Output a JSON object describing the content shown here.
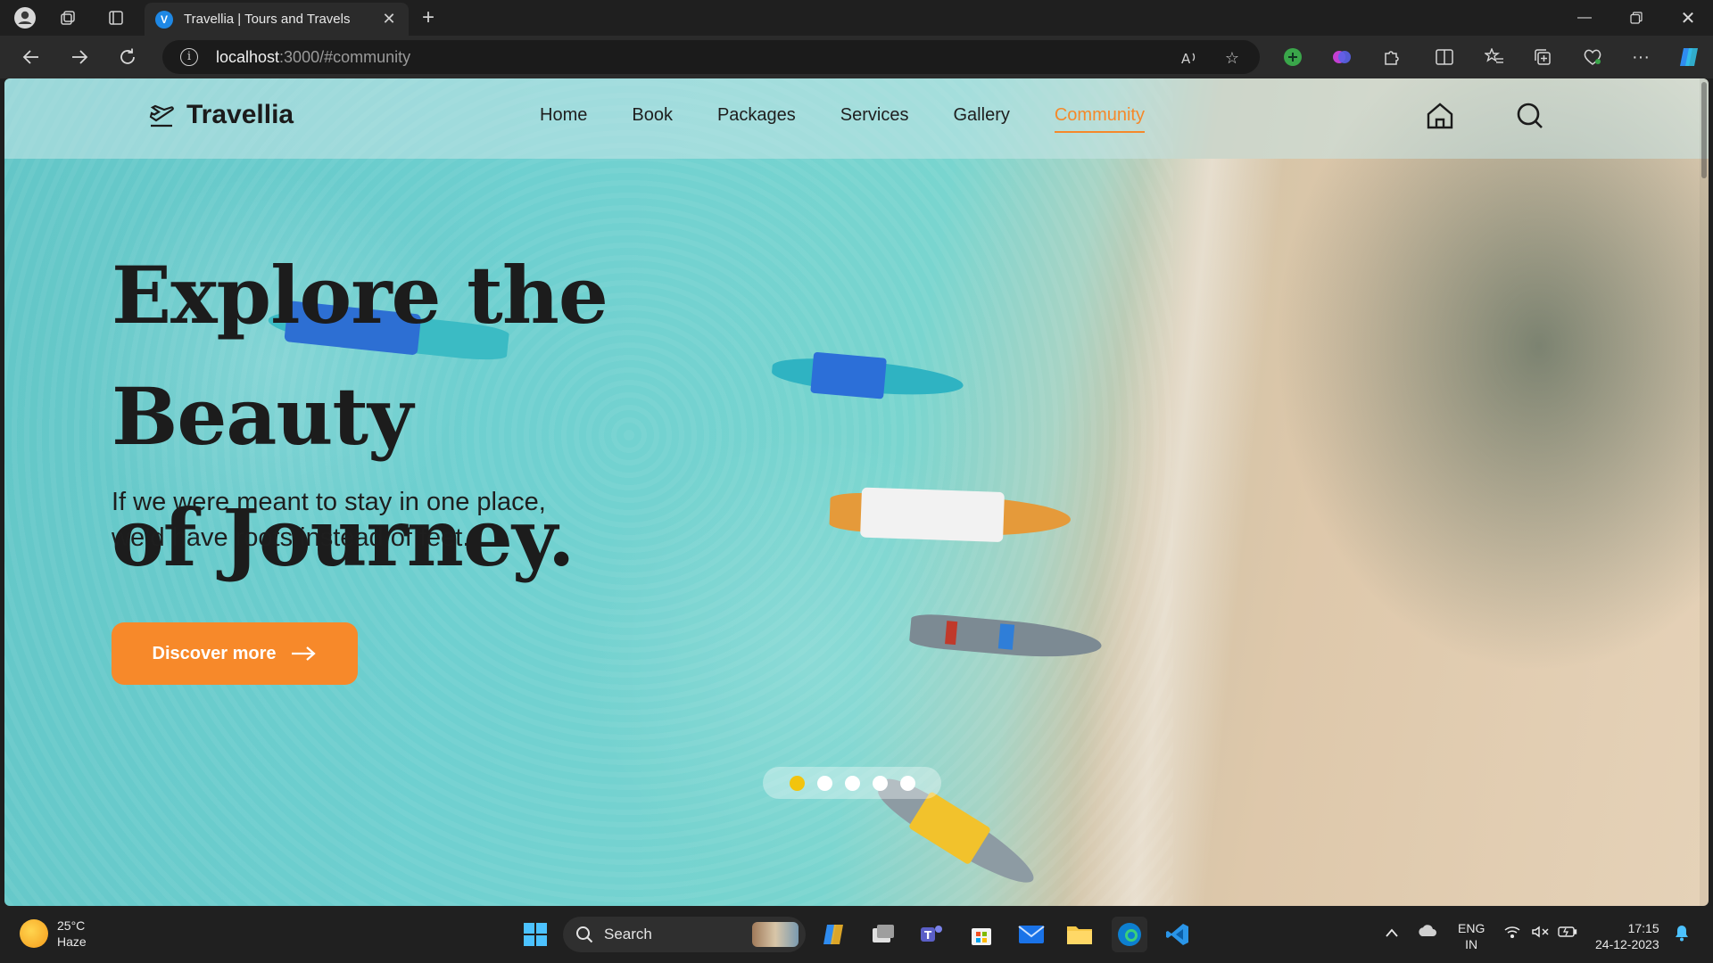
{
  "browser": {
    "tab_title": "Travellia | Tours and Travels",
    "tab_favicon_letter": "V",
    "url_host": "localhost",
    "url_rest": ":3000/#community"
  },
  "site": {
    "brand": "Travellia",
    "nav": [
      {
        "label": "Home",
        "active": false
      },
      {
        "label": "Book",
        "active": false
      },
      {
        "label": "Packages",
        "active": false
      },
      {
        "label": "Services",
        "active": false
      },
      {
        "label": "Gallery",
        "active": false
      },
      {
        "label": "Community",
        "active": true
      }
    ],
    "accent_color": "#f7892a",
    "hero": {
      "title_line1": "Explore the Beauty",
      "title_line2": "of Journey.",
      "subtitle_line1": "If we were meant to stay in one place,",
      "subtitle_line2": "we’d have roots instead of feet.",
      "cta_label": "Discover more"
    },
    "carousel": {
      "slide_count": 5,
      "active_index": 0,
      "active_color": "#f2c40e"
    }
  },
  "taskbar": {
    "weather_temp": "25°C",
    "weather_desc": "Haze",
    "search_label": "Search",
    "lang_line1": "ENG",
    "lang_line2": "IN",
    "time": "17:15",
    "date": "24-12-2023"
  }
}
